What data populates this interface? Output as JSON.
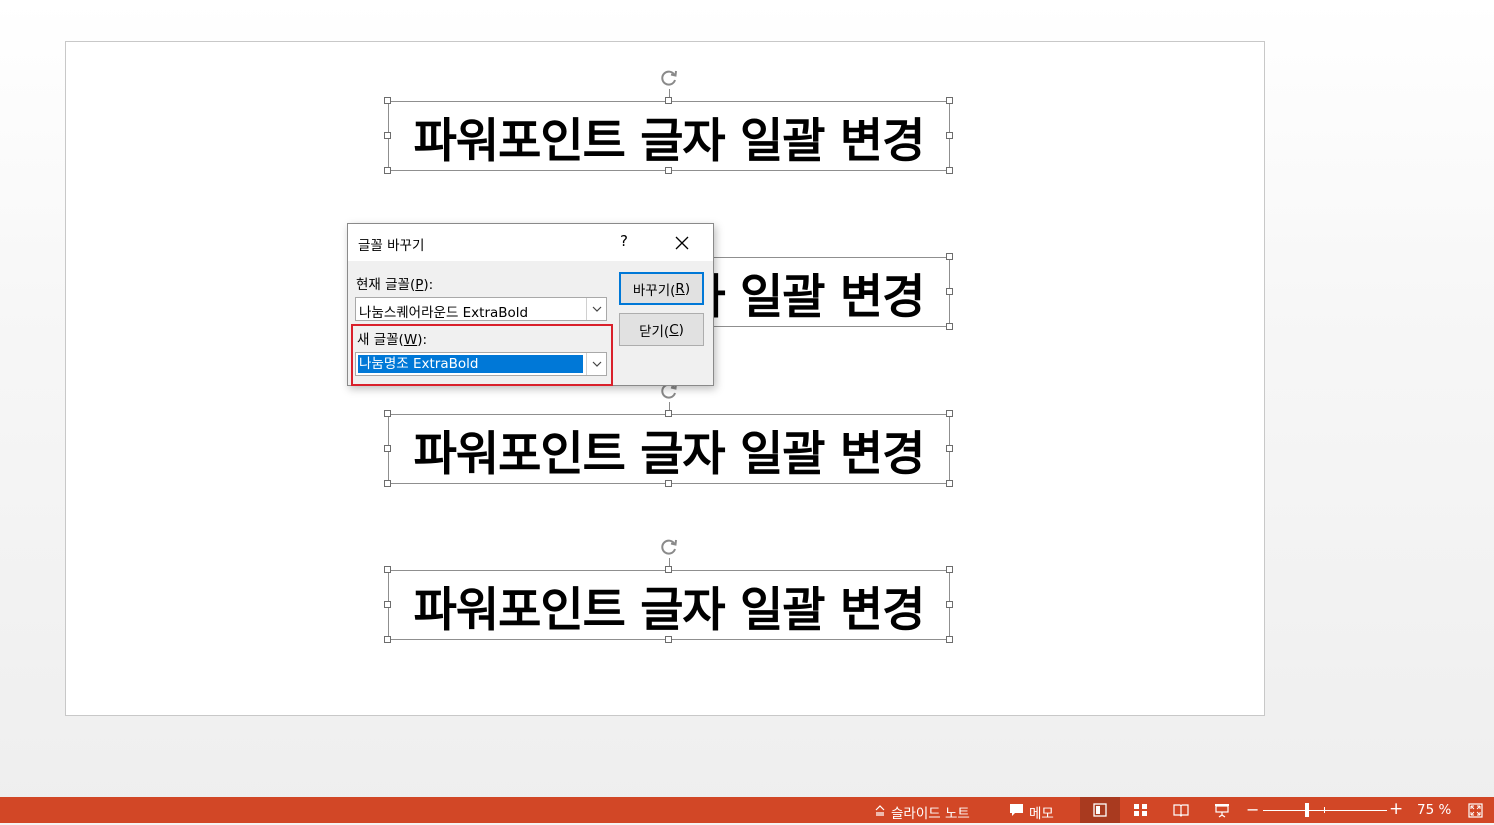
{
  "slide": {
    "textboxes": [
      {
        "text": "파워포인트 글자 일괄 변경",
        "rotate": true
      },
      {
        "text": "파워포인트 글자 일괄 변경",
        "rotate": false
      },
      {
        "text": "파워포인트 글자 일괄 변경",
        "rotate": true
      },
      {
        "text": "파워포인트 글자 일괄 변경",
        "rotate": true
      }
    ]
  },
  "dialog": {
    "title": "글꼴 바꾸기",
    "help": "?",
    "current_font_label": "현재 글꼴(",
    "current_font_key": "P",
    "current_font_label_end": "):",
    "current_font_value": "나눔스퀘어라운드 ExtraBold",
    "new_font_label": "새 글꼴(",
    "new_font_key": "W",
    "new_font_label_end": "):",
    "new_font_value": "나눔명조 ExtraBold",
    "replace_button": "바꾸기(",
    "replace_key": "R",
    "close_button": "닫기(",
    "close_key": "C",
    "paren_close": ")"
  },
  "statusbar": {
    "notes": "슬라이드 노트",
    "comments": "메모",
    "zoom_minus": "−",
    "zoom_plus": "+",
    "zoom_value": "75 %"
  },
  "colors": {
    "statusbar_bg": "#d24726",
    "selection": "#0078d7",
    "highlight_box": "#d9202b"
  }
}
